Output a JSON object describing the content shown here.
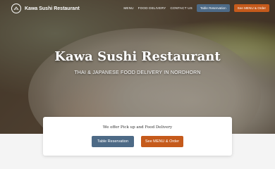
{
  "nav": {
    "brand": "Kawa Sushi Restaurant",
    "links": [
      "MENU",
      "FOOD DELIVERY",
      "CONTACT US"
    ],
    "table_reservation": "Table Reservation",
    "see_menu_order": "See MENU & Order"
  },
  "hero": {
    "title": "Kawa Sushi Restaurant",
    "subtitle": "THAI & JAPANESE FOOD DELIVERY IN NORDHORN"
  },
  "card": {
    "text": "We offer Pick up and Food Delivery",
    "table_reservation": "Table Reservation",
    "see_menu_order": "See MENU & Order"
  },
  "colors": {
    "primary_button": "#4d6a86",
    "accent_button": "#c55a1b"
  }
}
